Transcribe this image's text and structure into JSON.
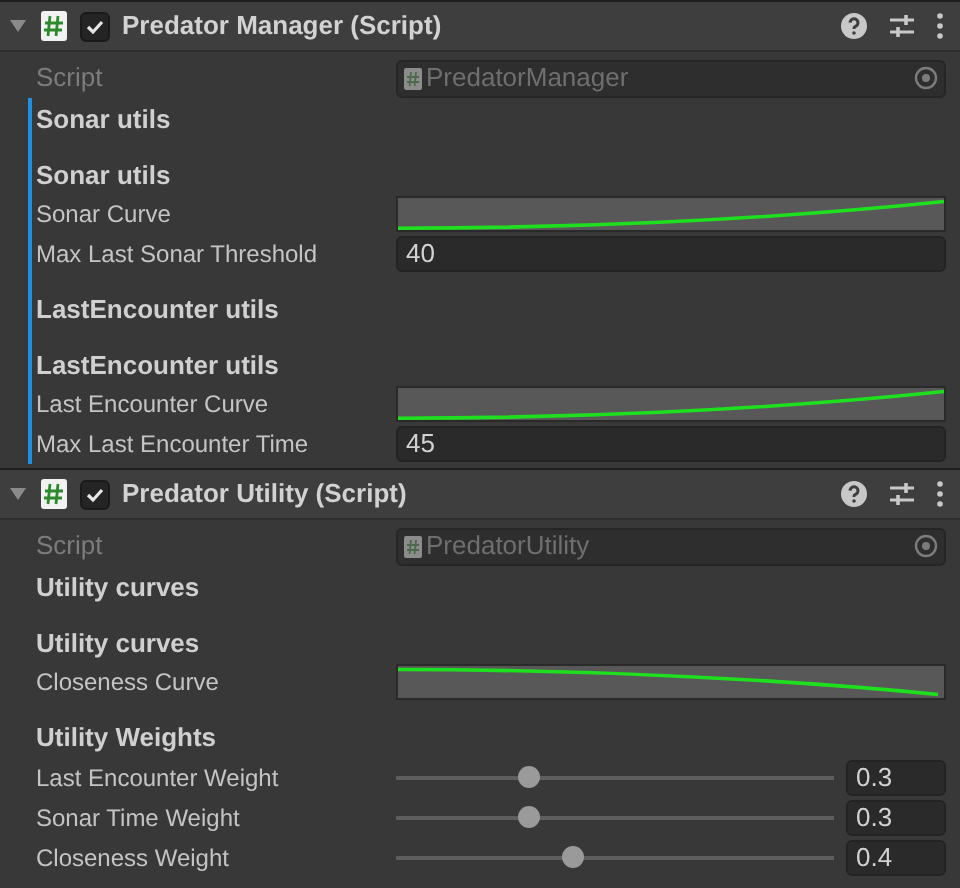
{
  "components": [
    {
      "title": "Predator Manager (Script)",
      "enabled": true,
      "expanded": true,
      "rows": [
        {
          "kind": "script",
          "label": "Script",
          "value": "PredatorManager",
          "disabled": true
        },
        {
          "kind": "header",
          "label": "Sonar utils",
          "marked": true
        },
        {
          "kind": "header",
          "label": "Sonar utils",
          "marked": true
        },
        {
          "kind": "rising-curve",
          "label": "Sonar Curve",
          "marked": true
        },
        {
          "kind": "number",
          "label": "Max Last Sonar Threshold",
          "value": "40",
          "marked": true
        },
        {
          "kind": "header",
          "label": "LastEncounter utils",
          "marked": true
        },
        {
          "kind": "header",
          "label": "LastEncounter utils",
          "marked": true
        },
        {
          "kind": "rising-curve",
          "label": "Last Encounter Curve",
          "marked": true
        },
        {
          "kind": "number",
          "label": "Max Last Encounter Time",
          "value": "45",
          "marked": true
        }
      ]
    },
    {
      "title": "Predator Utility (Script)",
      "enabled": true,
      "expanded": true,
      "rows": [
        {
          "kind": "script",
          "label": "Script",
          "value": "PredatorUtility",
          "disabled": true
        },
        {
          "kind": "header",
          "label": "Utility curves",
          "marked": false
        },
        {
          "kind": "header",
          "label": "Utility curves",
          "marked": false
        },
        {
          "kind": "falling-curve",
          "label": "Closeness Curve",
          "marked": false
        },
        {
          "kind": "header",
          "label": "Utility Weights",
          "marked": false
        },
        {
          "kind": "slider",
          "label": "Last Encounter Weight",
          "level": 0.3,
          "value": "0.3",
          "marked": false
        },
        {
          "kind": "slider",
          "label": "Sonar Time Weight",
          "level": 0.3,
          "value": "0.3",
          "marked": false
        },
        {
          "kind": "slider",
          "label": "Closeness Weight",
          "level": 0.4,
          "value": "0.4",
          "marked": false
        }
      ]
    }
  ]
}
